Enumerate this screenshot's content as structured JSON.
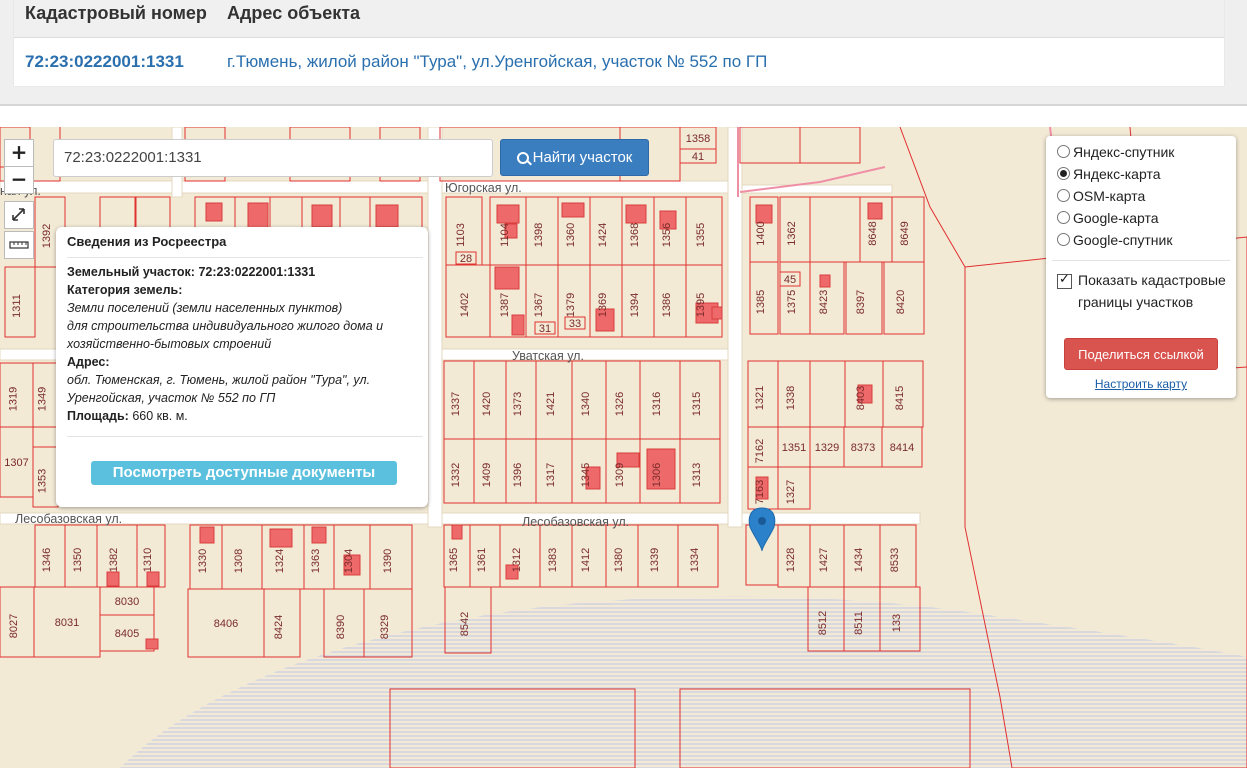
{
  "table": {
    "col_number": "Кадастровый номер",
    "col_address": "Адрес объекта",
    "row_number": "72:23:0222001:1331",
    "row_address": "г.Тюмень, жилой район \"Тура\", ул.Уренгойская, участок № 552 по ГП"
  },
  "map": {
    "search_value": "72:23:0222001:1331",
    "find_button": "Найти участок",
    "zoom_in": "+",
    "zoom_out": "−",
    "streets": [
      "Югорская ул.",
      "Уватская ул.",
      "Лесобазовская ул.",
      "Лесобазовская ул.",
      "ная ул."
    ],
    "parcels": [
      "1358",
      "41",
      "1392",
      "1311",
      "1103",
      "1104",
      "1398",
      "1360",
      "1424",
      "1368",
      "1356",
      "1355",
      "28",
      "1402",
      "1387",
      "1367",
      "1379",
      "1369",
      "1394",
      "1386",
      "1395",
      "31",
      "33",
      "1400",
      "1362",
      "8648",
      "8649",
      "1385",
      "1375",
      "8423",
      "8397",
      "8420",
      "45",
      "1337",
      "1420",
      "1373",
      "1421",
      "1340",
      "1326",
      "1316",
      "1315",
      "1332",
      "1409",
      "1396",
      "1317",
      "1345",
      "1309",
      "1306",
      "1313",
      "1321",
      "1338",
      "8403",
      "8415",
      "7162",
      "1351",
      "1329",
      "8373",
      "8414",
      "7163",
      "1327",
      "1319",
      "1349",
      "1307",
      "1353",
      "1346",
      "1350",
      "1382",
      "1310",
      "1330",
      "1308",
      "1324",
      "1363",
      "1304",
      "1390",
      "1365",
      "1361",
      "1312",
      "1383",
      "1412",
      "1380",
      "1339",
      "1334",
      "1328",
      "1427",
      "1434",
      "8533",
      "8027",
      "8031",
      "8030",
      "8405",
      "8406",
      "8424",
      "8390",
      "8329",
      "8542",
      "8512",
      "8511",
      "133"
    ]
  },
  "popup": {
    "title": "Сведения из Росреестра",
    "parcel_label": "Земельный участок:",
    "parcel_value": "72:23:0222001:1331",
    "category_label": "Категория земель:",
    "category_line1": "Земли поселений (земли населенных пунктов)",
    "category_line2": "для строительства индивидуального жилого дома и",
    "category_line3": "хозяйственно-бытовых строений",
    "address_label": "Адрес:",
    "address_line1": "обл. Тюменская, г. Тюмень, жилой район \"Тура\", ул.",
    "address_line2": "Уренгойская, участок № 552 по ГП",
    "area_label": "Площадь:",
    "area_value": "660 кв. м.",
    "docs_button": "Посмотреть доступные документы"
  },
  "layers": {
    "options": [
      "Яндекс-спутник",
      "Яндекс-карта",
      "OSM-карта",
      "Google-карта",
      "Google-спутник"
    ],
    "selected": 1,
    "checkbox_label": "Показать кадастровые границы участков",
    "share_button": "Поделиться ссылкой",
    "setup_link": "Настроить карту"
  },
  "colors": {
    "link_blue": "#2a6fae",
    "button_blue": "#3a7ec0",
    "info_button": "#5bc0de",
    "share_red": "#d9534f",
    "parcel_border": "#e03030",
    "map_bg": "#f3ead6",
    "water_hatch": "#c5cbe0"
  }
}
